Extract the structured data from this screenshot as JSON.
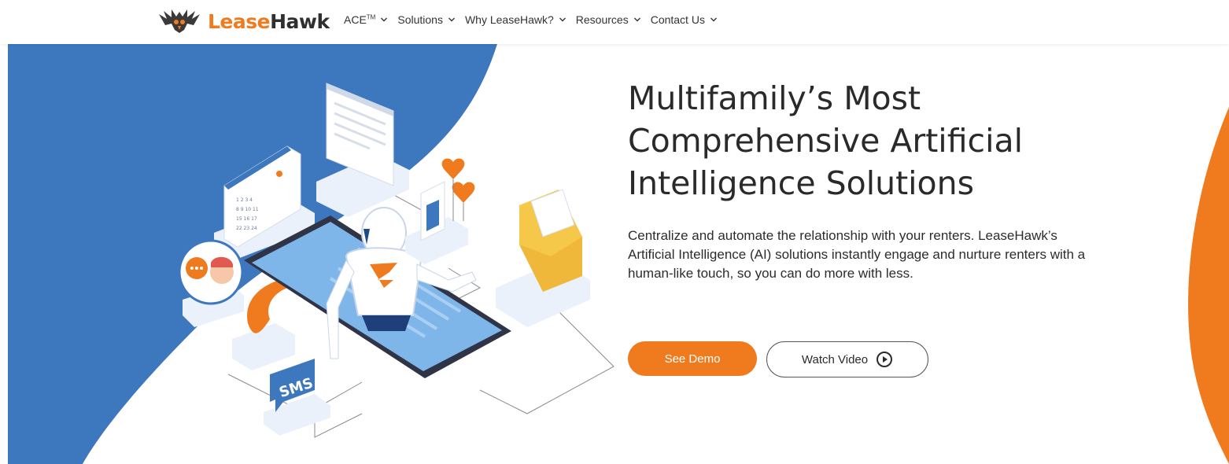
{
  "nav": {
    "logo_text_a": "Lease",
    "logo_text_b": "Hawk",
    "items": [
      {
        "label": "ACE",
        "sup": "TM"
      },
      {
        "label": "Solutions"
      },
      {
        "label": "Why LeaseHawk?"
      },
      {
        "label": "Resources"
      },
      {
        "label": "Contact Us"
      }
    ]
  },
  "hero": {
    "headline": "Multifamily’s Most Comprehensive Artificial Intelligence Solutions",
    "description": "Centralize and automate the relationship with your renters. LeaseHawk’s Artificial Intelligence (AI) solutions instantly engage and nurture renters with a human-like touch, so you can do more with less.",
    "cta_demo": "See Demo",
    "cta_video": "Watch Video",
    "illustration_label": "SMS"
  },
  "colors": {
    "brand_orange": "#f07b1f",
    "hero_blue": "#3d78bf",
    "hero_cream": "#fdf6ee"
  },
  "icons": [
    "hawk-logo-icon",
    "chevron-down-icon",
    "play-circle-icon",
    "calendar-icon",
    "chat-icon",
    "phone-icon",
    "envelope-icon",
    "like-icon",
    "heart-icon",
    "robot-icon",
    "smartphone-icon"
  ]
}
